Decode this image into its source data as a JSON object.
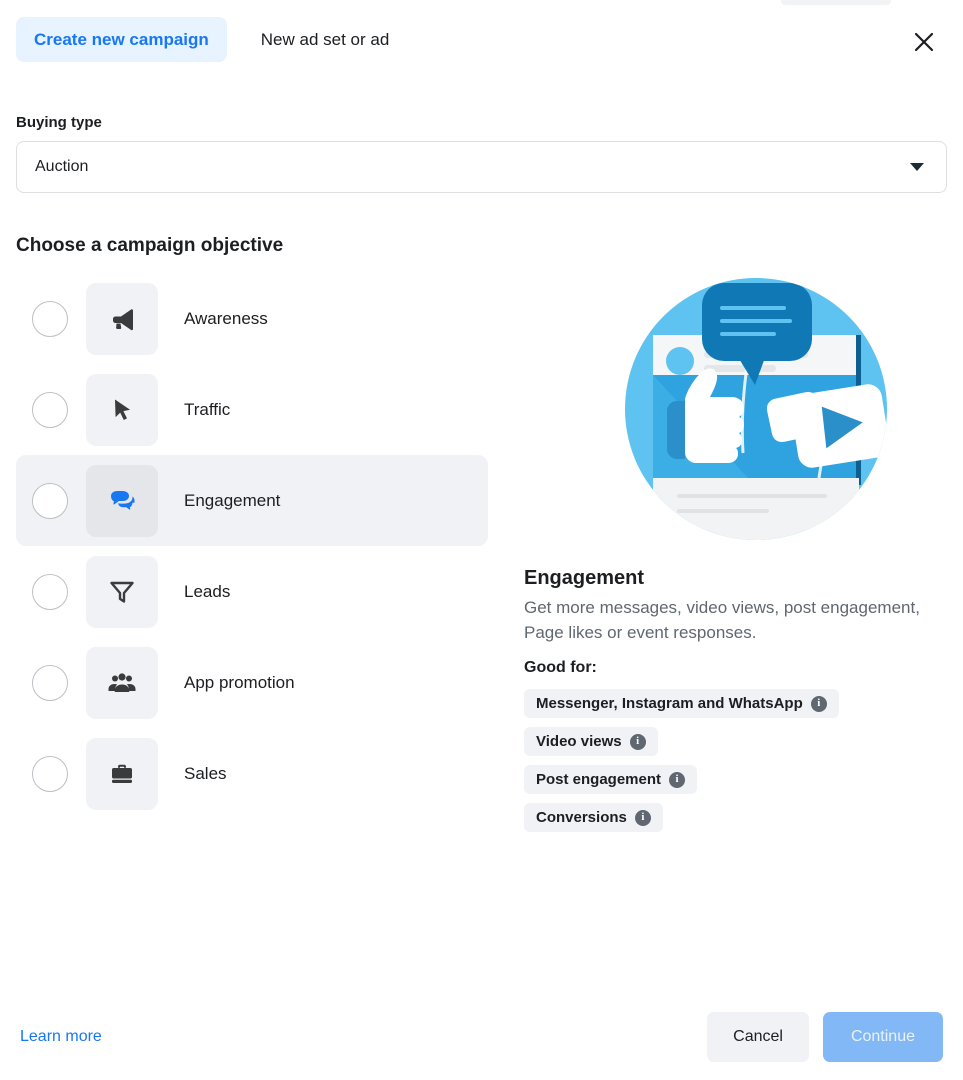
{
  "header": {
    "tabs": [
      {
        "label": "Create new campaign",
        "active": true
      },
      {
        "label": "New ad set or ad",
        "active": false
      }
    ],
    "close_icon": "close-icon"
  },
  "buying_type": {
    "label": "Buying type",
    "value": "Auction",
    "caret_icon": "chevron-down-icon"
  },
  "objective_section": {
    "title": "Choose a campaign objective",
    "options": [
      {
        "label": "Awareness",
        "icon": "megaphone-icon",
        "selected": false
      },
      {
        "label": "Traffic",
        "icon": "cursor-arrow-icon",
        "selected": false
      },
      {
        "label": "Engagement",
        "icon": "chat-bubbles-icon",
        "selected": true
      },
      {
        "label": "Leads",
        "icon": "funnel-icon",
        "selected": false
      },
      {
        "label": "App promotion",
        "icon": "people-group-icon",
        "selected": false
      },
      {
        "label": "Sales",
        "icon": "briefcase-icon",
        "selected": false
      }
    ]
  },
  "detail": {
    "illustration": "engagement-illustration",
    "title": "Engagement",
    "description": "Get more messages, video views, post engagement, Page likes or event responses.",
    "good_for_label": "Good for:",
    "tags": [
      {
        "label": "Messenger, Instagram and WhatsApp",
        "info_icon": "info-icon"
      },
      {
        "label": "Video views",
        "info_icon": "info-icon"
      },
      {
        "label": "Post engagement",
        "info_icon": "info-icon"
      },
      {
        "label": "Conversions",
        "info_icon": "info-icon"
      }
    ]
  },
  "footer": {
    "learn_more": "Learn more",
    "cancel": "Cancel",
    "continue": "Continue"
  },
  "colors": {
    "accent_blue": "#1877f2",
    "tab_active_bg": "#e7f3ff",
    "surface_gray": "#f0f2f5",
    "selected_tile": "#e4e6e9",
    "continue_disabled": "#82b8f5",
    "illustration_blue": "#2ea3e0",
    "illustration_dark_blue": "#1079b5"
  }
}
